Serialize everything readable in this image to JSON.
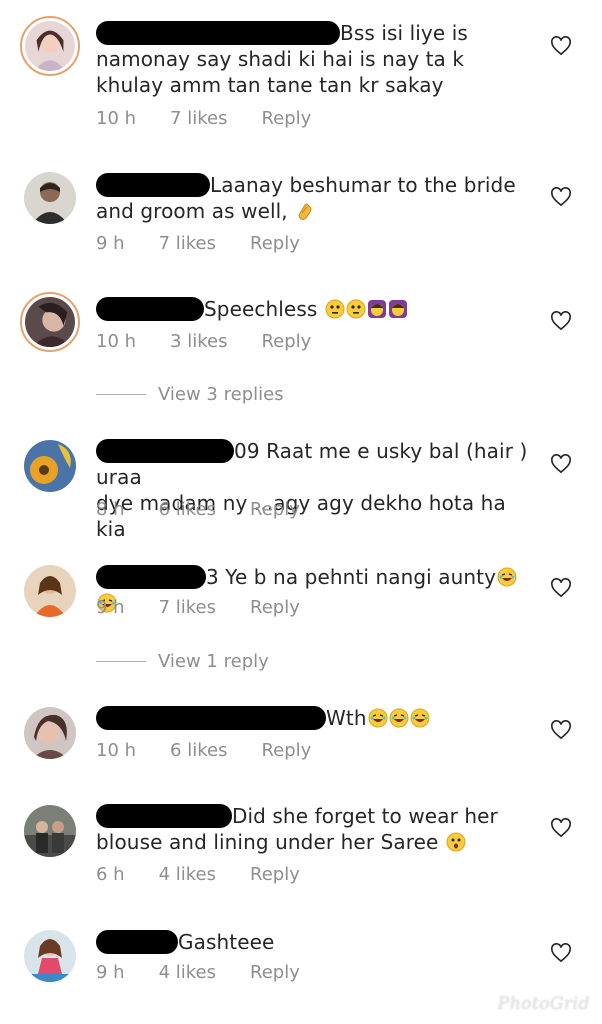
{
  "comments": [
    {
      "text_line1": "Bss isi liye is",
      "text_rest": "namonay say shadi ki hai is nay ta k khulay amm tan tane tan kr sakay",
      "time": "10 h",
      "likes": "7 likes",
      "reply": "Reply"
    },
    {
      "text_line1": "Laanay beshumar to the bride",
      "text_rest": "and groom as well, ",
      "time": "9 h",
      "likes": "7 likes",
      "reply": "Reply"
    },
    {
      "text_line1": "Speechless ",
      "time": "10 h",
      "likes": "3 likes",
      "reply": "Reply",
      "view_replies": "View 3 replies"
    },
    {
      "text_line1": "09 Raat me e usky bal (hair ) uraa",
      "text_rest": "dye madam ny ...agy agy dekho hota ha kia",
      "time": "8 h",
      "likes": "6 likes",
      "reply": "Reply"
    },
    {
      "text_line1": "3 Ye b na pehnti nangi aunty",
      "time": "9 h",
      "likes": "7 likes",
      "reply": "Reply",
      "view_replies": "View 1 reply"
    },
    {
      "text_line1": "Wth",
      "time": "10 h",
      "likes": "6 likes",
      "reply": "Reply"
    },
    {
      "text_line1": "Did she forget to wear her",
      "text_rest": "blouse and lining under her Saree ",
      "time": "6 h",
      "likes": "4 likes",
      "reply": "Reply"
    },
    {
      "text_line1": "Gashteee",
      "time": "9 h",
      "likes": "4 likes",
      "reply": "Reply"
    }
  ],
  "watermark": "PhotoGrid",
  "icons": {
    "like": "heart-outline-icon",
    "emoji_laugh": "laughing-emoji-icon",
    "emoji_clap": "clap-emoji-icon"
  }
}
